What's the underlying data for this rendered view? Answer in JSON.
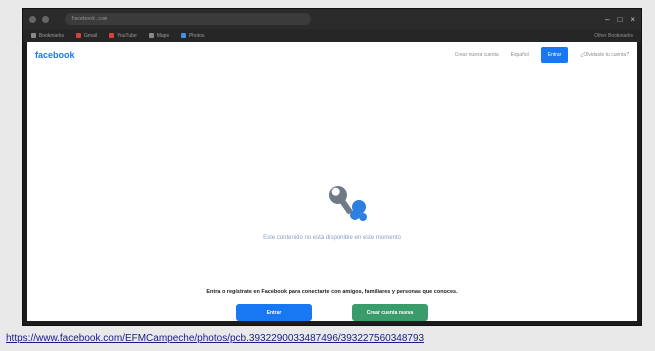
{
  "browser": {
    "url": "facebook.com",
    "bookmarks": [
      "Bookmarks",
      "Gmail",
      "YouTube",
      "Maps",
      "Photos"
    ],
    "other_bookmarks": "Other Bookmarks"
  },
  "facebook": {
    "logo": "facebook",
    "nav_links": [
      "Crear nueva cuenta",
      "Español"
    ],
    "login_button": "Entrar",
    "forgot_link": "¿Olvidaste tu cuenta?",
    "unavailable_message": "Este contenido no está disponible en este momento",
    "login_prompt": "Entra o regístrate en Facebook para conectarte con amigos, familiares y personas que conoces.",
    "buttons": {
      "login": "Entrar",
      "create_account": "Crear cuenta nueva"
    }
  },
  "caption": {
    "url_text": "https://www.facebook.com/EFMCampeche/photos/pcb.393229003348749​6/393227560348793"
  },
  "colors": {
    "facebook_blue": "#1877f2",
    "create_green": "#3a9c6a",
    "browser_dark": "#2b2b2b"
  },
  "icons": [
    "wrench-icon",
    "close-icon",
    "minimize-icon",
    "maximize-icon"
  ]
}
